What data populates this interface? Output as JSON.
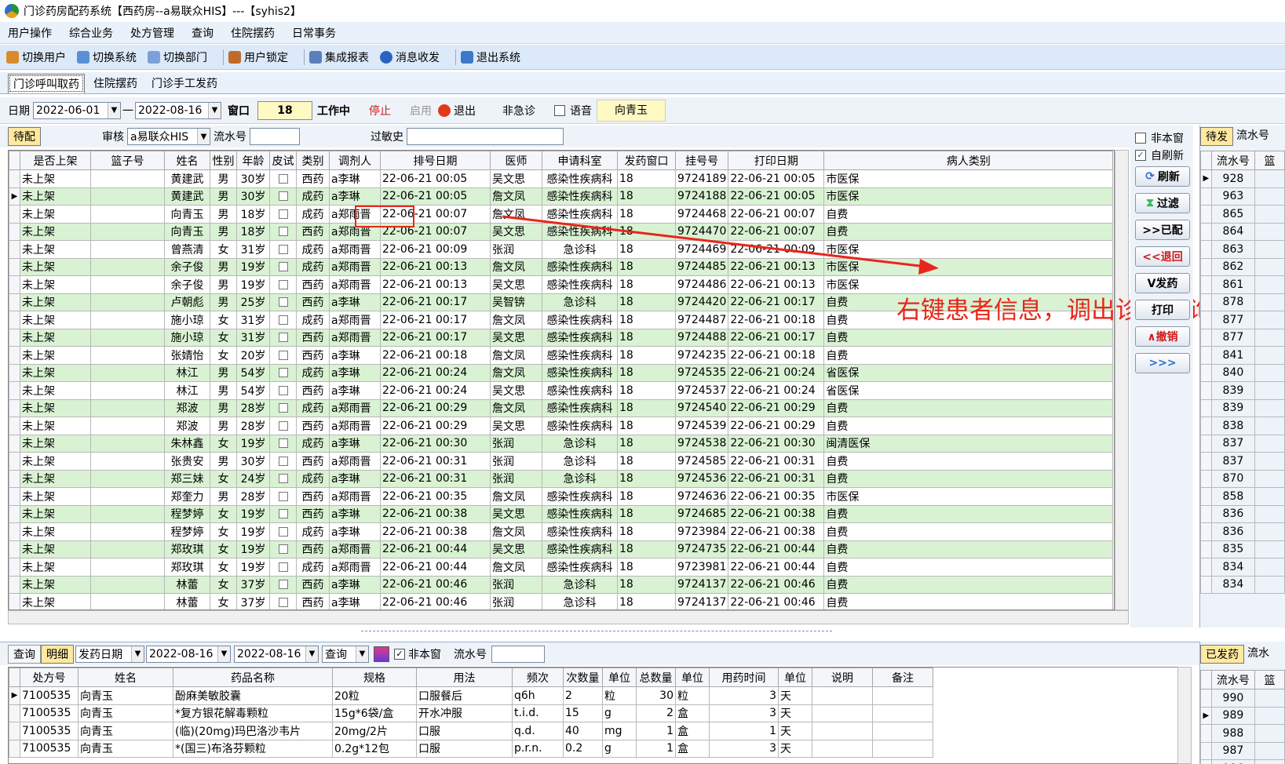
{
  "window": {
    "title": "门诊药房配药系统【西药房--a易联众HIS】---【syhis2】"
  },
  "menu": [
    "用户操作",
    "综合业务",
    "处方管理",
    "查询",
    "住院摆药",
    "日常事务"
  ],
  "toolbar": [
    {
      "label": "切换用户",
      "icon": "users-icon"
    },
    {
      "label": "切换系统",
      "icon": "switch-system-icon"
    },
    {
      "label": "切换部门",
      "icon": "department-icon"
    },
    {
      "label": "用户锁定",
      "icon": "lock-user-icon"
    },
    {
      "label": "集成报表",
      "icon": "report-icon"
    },
    {
      "label": "消息收发",
      "icon": "info-icon"
    },
    {
      "label": "退出系统",
      "icon": "exit-icon"
    }
  ],
  "tabs": [
    "门诊呼叫取药",
    "住院摆药",
    "门诊手工发药"
  ],
  "filter": {
    "date_label": "日期",
    "date_from": "2022-06-01",
    "dash": "一",
    "date_to": "2022-08-16",
    "window_label": "窗口",
    "window_value": "18",
    "status": "工作中",
    "stop": "停止",
    "enable": "启用",
    "exit": "退出",
    "non_emergency": "非急诊",
    "voice": "语音",
    "user": "向青玉"
  },
  "subfilter": {
    "pending_tab": "待配",
    "review_label": "审核",
    "review_value": "a易联众HIS",
    "serial_label": "流水号",
    "allergy_label": "过敏史"
  },
  "main_grid": {
    "columns": [
      "是否上架",
      "篮子号",
      "姓名",
      "性别",
      "年龄",
      "皮试",
      "类别",
      "调剂人",
      "排号日期",
      "医师",
      "申请科室",
      "发药窗口",
      "挂号号",
      "打印日期",
      "病人类别"
    ],
    "rows": [
      [
        "未上架",
        "",
        "黄建武",
        "男",
        "30岁",
        "",
        "西药",
        "a李琳",
        "22-06-21 00:05",
        "吴文思",
        "感染性疾病科",
        "18",
        "9724189",
        "22-06-21 00:05",
        "市医保"
      ],
      [
        "未上架",
        "",
        "黄建武",
        "男",
        "30岁",
        "",
        "成药",
        "a李琳",
        "22-06-21 00:05",
        "詹文凤",
        "感染性疾病科",
        "18",
        "9724188",
        "22-06-21 00:05",
        "市医保"
      ],
      [
        "未上架",
        "",
        "向青玉",
        "男",
        "18岁",
        "",
        "成药",
        "a郑雨晋",
        "22-06-21 00:07",
        "詹文凤",
        "感染性疾病科",
        "18",
        "9724468",
        "22-06-21 00:07",
        "自费"
      ],
      [
        "未上架",
        "",
        "向青玉",
        "男",
        "18岁",
        "",
        "西药",
        "a郑雨晋",
        "22-06-21 00:07",
        "吴文思",
        "感染性疾病科",
        "18",
        "9724470",
        "22-06-21 00:07",
        "自费"
      ],
      [
        "未上架",
        "",
        "曾燕清",
        "女",
        "31岁",
        "",
        "成药",
        "a郑雨晋",
        "22-06-21 00:09",
        "张润",
        "急诊科",
        "18",
        "9724469",
        "22-06-21 00:09",
        "市医保"
      ],
      [
        "未上架",
        "",
        "余子俊",
        "男",
        "19岁",
        "",
        "成药",
        "a郑雨晋",
        "22-06-21 00:13",
        "詹文凤",
        "感染性疾病科",
        "18",
        "9724485",
        "22-06-21 00:13",
        "市医保"
      ],
      [
        "未上架",
        "",
        "余子俊",
        "男",
        "19岁",
        "",
        "西药",
        "a郑雨晋",
        "22-06-21 00:13",
        "吴文思",
        "感染性疾病科",
        "18",
        "9724486",
        "22-06-21 00:13",
        "市医保"
      ],
      [
        "未上架",
        "",
        "卢朝彪",
        "男",
        "25岁",
        "",
        "西药",
        "a李琳",
        "22-06-21 00:17",
        "吴智锛",
        "急诊科",
        "18",
        "9724420",
        "22-06-21 00:17",
        "自费"
      ],
      [
        "未上架",
        "",
        "施小琼",
        "女",
        "31岁",
        "",
        "成药",
        "a郑雨晋",
        "22-06-21 00:17",
        "詹文凤",
        "感染性疾病科",
        "18",
        "9724487",
        "22-06-21 00:18",
        "自费"
      ],
      [
        "未上架",
        "",
        "施小琼",
        "女",
        "31岁",
        "",
        "西药",
        "a郑雨晋",
        "22-06-21 00:17",
        "吴文思",
        "感染性疾病科",
        "18",
        "9724488",
        "22-06-21 00:17",
        "自费"
      ],
      [
        "未上架",
        "",
        "张婧怡",
        "女",
        "20岁",
        "",
        "西药",
        "a李琳",
        "22-06-21 00:18",
        "詹文凤",
        "感染性疾病科",
        "18",
        "9724235",
        "22-06-21 00:18",
        "自费"
      ],
      [
        "未上架",
        "",
        "林江",
        "男",
        "54岁",
        "",
        "成药",
        "a李琳",
        "22-06-21 00:24",
        "詹文凤",
        "感染性疾病科",
        "18",
        "9724535",
        "22-06-21 00:24",
        "省医保"
      ],
      [
        "未上架",
        "",
        "林江",
        "男",
        "54岁",
        "",
        "西药",
        "a李琳",
        "22-06-21 00:24",
        "吴文思",
        "感染性疾病科",
        "18",
        "9724537",
        "22-06-21 00:24",
        "省医保"
      ],
      [
        "未上架",
        "",
        "郑波",
        "男",
        "28岁",
        "",
        "成药",
        "a郑雨晋",
        "22-06-21 00:29",
        "詹文凤",
        "感染性疾病科",
        "18",
        "9724540",
        "22-06-21 00:29",
        "自费"
      ],
      [
        "未上架",
        "",
        "郑波",
        "男",
        "28岁",
        "",
        "西药",
        "a郑雨晋",
        "22-06-21 00:29",
        "吴文思",
        "感染性疾病科",
        "18",
        "9724539",
        "22-06-21 00:29",
        "自费"
      ],
      [
        "未上架",
        "",
        "朱林鑫",
        "女",
        "19岁",
        "",
        "成药",
        "a李琳",
        "22-06-21 00:30",
        "张润",
        "急诊科",
        "18",
        "9724538",
        "22-06-21 00:30",
        "闽清医保"
      ],
      [
        "未上架",
        "",
        "张贵安",
        "男",
        "30岁",
        "",
        "西药",
        "a郑雨晋",
        "22-06-21 00:31",
        "张润",
        "急诊科",
        "18",
        "9724585",
        "22-06-21 00:31",
        "自费"
      ],
      [
        "未上架",
        "",
        "郑三妹",
        "女",
        "24岁",
        "",
        "成药",
        "a李琳",
        "22-06-21 00:31",
        "张润",
        "急诊科",
        "18",
        "9724536",
        "22-06-21 00:31",
        "自费"
      ],
      [
        "未上架",
        "",
        "郑奎力",
        "男",
        "28岁",
        "",
        "西药",
        "a郑雨晋",
        "22-06-21 00:35",
        "詹文凤",
        "感染性疾病科",
        "18",
        "9724636",
        "22-06-21 00:35",
        "市医保"
      ],
      [
        "未上架",
        "",
        "程梦婷",
        "女",
        "19岁",
        "",
        "西药",
        "a李琳",
        "22-06-21 00:38",
        "吴文思",
        "感染性疾病科",
        "18",
        "9724685",
        "22-06-21 00:38",
        "自费"
      ],
      [
        "未上架",
        "",
        "程梦婷",
        "女",
        "19岁",
        "",
        "成药",
        "a李琳",
        "22-06-21 00:38",
        "詹文凤",
        "感染性疾病科",
        "18",
        "9723984",
        "22-06-21 00:38",
        "自费"
      ],
      [
        "未上架",
        "",
        "郑玫琪",
        "女",
        "19岁",
        "",
        "西药",
        "a郑雨晋",
        "22-06-21 00:44",
        "吴文思",
        "感染性疾病科",
        "18",
        "9724735",
        "22-06-21 00:44",
        "自费"
      ],
      [
        "未上架",
        "",
        "郑玫琪",
        "女",
        "19岁",
        "",
        "成药",
        "a郑雨晋",
        "22-06-21 00:44",
        "詹文凤",
        "感染性疾病科",
        "18",
        "9723981",
        "22-06-21 00:44",
        "自费"
      ],
      [
        "未上架",
        "",
        "林蕾",
        "女",
        "37岁",
        "",
        "西药",
        "a李琳",
        "22-06-21 00:46",
        "张润",
        "急诊科",
        "18",
        "9724137",
        "22-06-21 00:46",
        "自费"
      ],
      [
        "未上架",
        "",
        "林蕾",
        "女",
        "37岁",
        "",
        "西药",
        "a李琳",
        "22-06-21 00:46",
        "张润",
        "急诊科",
        "18",
        "9724137",
        "22-06-21 00:46",
        "自费"
      ]
    ]
  },
  "side_options": {
    "non_window": "非本窗",
    "auto_refresh": "自刷新"
  },
  "side_buttons": [
    "刷新",
    "过滤",
    ">>已配",
    "<<退回",
    "V发药",
    "打印",
    "∧撤销",
    ">>>"
  ],
  "annotation": "右键患者信息，调出诊疗查询系统",
  "right_panel": {
    "tab": "待发",
    "tab2": "流水号",
    "col1": "流水号",
    "col2": "篮",
    "serials": [
      "928",
      "963",
      "865",
      "864",
      "863",
      "862",
      "861",
      "878",
      "877",
      "877",
      "841",
      "840",
      "839",
      "839",
      "838",
      "837",
      "837",
      "870",
      "858",
      "836",
      "836",
      "835",
      "834",
      "834"
    ]
  },
  "bottom": {
    "query": "查询",
    "detail": "明细",
    "date_type": "发药日期",
    "date_from": "2022-08-16",
    "date_to": "2022-08-16",
    "query_btn": "查询",
    "non_window": "非本窗",
    "serial_label": "流水号"
  },
  "detail_grid": {
    "columns": [
      "处方号",
      "姓名",
      "药品名称",
      "规格",
      "用法",
      "频次",
      "次数量",
      "单位",
      "总数量",
      "单位",
      "用药时间",
      "单位",
      "说明",
      "备注"
    ],
    "rows": [
      [
        "7100535",
        "向青玉",
        "酚麻美敏胶囊",
        "20粒",
        "口服餐后",
        "q6h",
        "2",
        "粒",
        "30",
        "粒",
        "3",
        "天",
        "",
        ""
      ],
      [
        "7100535",
        "向青玉",
        "*复方银花解毒颗粒",
        "15g*6袋/盒",
        "开水冲服",
        "t.i.d.",
        "15",
        "g",
        "2",
        "盒",
        "3",
        "天",
        "",
        ""
      ],
      [
        "7100535",
        "向青玉",
        "(临)(20mg)玛巴洛沙韦片",
        "20mg/2片",
        "口服",
        "q.d.",
        "40",
        "mg",
        "1",
        "盒",
        "1",
        "天",
        "",
        ""
      ],
      [
        "7100535",
        "向青玉",
        "*(国三)布洛芬颗粒",
        "0.2g*12包",
        "口服",
        "p.r.n.",
        "0.2",
        "g",
        "1",
        "盒",
        "3",
        "天",
        "",
        ""
      ]
    ]
  },
  "right_panel2": {
    "tab": "已发药",
    "tab2": "流水",
    "col1": "流水号",
    "col2": "篮",
    "serials": [
      "990",
      "989",
      "988",
      "987",
      "986"
    ]
  },
  "colors": {
    "row_green": "#d9f2d3",
    "annotation_red": "#e8261c",
    "window_yellow": "#fff9c4"
  }
}
